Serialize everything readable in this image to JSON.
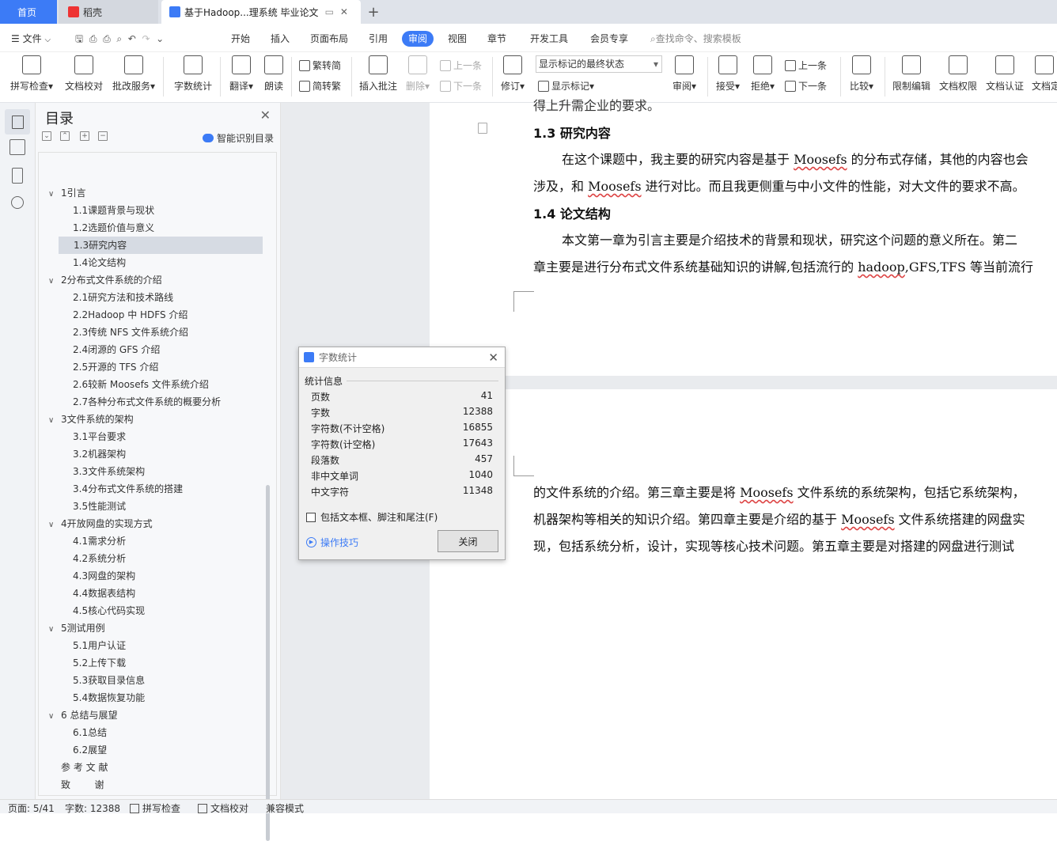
{
  "tabs": {
    "home": "首页",
    "daoke": "稻壳",
    "doc": "基于Hadoop...理系统 毕业论文",
    "add": "+"
  },
  "menu": {
    "file": "文件",
    "items": [
      "开始",
      "插入",
      "页面布局",
      "引用",
      "审阅",
      "视图",
      "章节",
      "开发工具",
      "会员专享"
    ],
    "search": "查找命令、搜索模板"
  },
  "ribbon": {
    "spell": "拼写检查",
    "proof": "文档校对",
    "batch": "批改服务",
    "wordcount": "字数统计",
    "translate": "翻译",
    "read": "朗读",
    "trad": "繁转简",
    "simp": "简转繁",
    "insert_comment": "插入批注",
    "delete": "删除",
    "prev_comment": "上一条",
    "next_comment": "下一条",
    "revise": "修订",
    "markup_state": "显示标记的最终状态",
    "show_markup": "显示标记",
    "review": "审阅",
    "accept": "接受",
    "reject": "拒绝",
    "prev": "上一条",
    "next": "下一条",
    "compare": "比较",
    "restrict": "限制编辑",
    "permission": "文档权限",
    "certify": "文档认证",
    "doc_more": "文档定"
  },
  "toc": {
    "title": "目录",
    "smart": "智能识别目录",
    "items": [
      {
        "text": "1引言",
        "level": 1
      },
      {
        "text": "1.1课题背景与现状",
        "level": 2
      },
      {
        "text": "1.2选题价值与意义",
        "level": 2
      },
      {
        "text": "1.3研究内容",
        "level": 2,
        "selected": true
      },
      {
        "text": "1.4论文结构",
        "level": 2
      },
      {
        "text": "2分布式文件系统的介绍",
        "level": 1
      },
      {
        "text": "2.1研究方法和技术路线",
        "level": 2
      },
      {
        "text": "2.2Hadoop 中 HDFS 介绍",
        "level": 2
      },
      {
        "text": "2.3传统 NFS 文件系统介绍",
        "level": 2
      },
      {
        "text": "2.4闭源的 GFS 介绍",
        "level": 2
      },
      {
        "text": "2.5开源的 TFS 介绍",
        "level": 2
      },
      {
        "text": "2.6较新 Moosefs 文件系统介绍",
        "level": 2
      },
      {
        "text": "2.7各种分布式文件系统的概要分析",
        "level": 2
      },
      {
        "text": "3文件系统的架构",
        "level": 1
      },
      {
        "text": "3.1平台要求",
        "level": 2
      },
      {
        "text": "3.2机器架构",
        "level": 2
      },
      {
        "text": "3.3文件系统架构",
        "level": 2
      },
      {
        "text": "3.4分布式文件系统的搭建",
        "level": 2
      },
      {
        "text": "3.5性能测试",
        "level": 2
      },
      {
        "text": "4开放网盘的实现方式",
        "level": 1
      },
      {
        "text": "4.1需求分析",
        "level": 2
      },
      {
        "text": "4.2系统分析",
        "level": 2
      },
      {
        "text": "4.3网盘的架构",
        "level": 2
      },
      {
        "text": "4.4数据表结构",
        "level": 2
      },
      {
        "text": "4.5核心代码实现",
        "level": 2
      },
      {
        "text": "5测试用例",
        "level": 1
      },
      {
        "text": "5.1用户认证",
        "level": 2
      },
      {
        "text": "5.2上传下载",
        "level": 2
      },
      {
        "text": "5.3获取目录信息",
        "level": 2
      },
      {
        "text": "5.4数据恢复功能",
        "level": 2
      },
      {
        "text": "6 总结与展望",
        "level": 1
      },
      {
        "text": "6.1总结",
        "level": 2
      },
      {
        "text": "6.2展望",
        "level": 2
      },
      {
        "text": "参 考 文 献",
        "level": 0
      },
      {
        "text": "致        谢",
        "level": 0
      }
    ]
  },
  "document": {
    "line0": "得上升需企业的要求。",
    "h13": "1.3  研究内容",
    "p1a_pre": "在这个课题中，我主要的研究内容是基于 ",
    "p1a_w": "Moosefs",
    "p1a_post": " 的分布式存储，其他的内容也会",
    "p1b_pre": "涉及，和 ",
    "p1b_w": "Moosefs",
    "p1b_post": " 进行对比。而且我更侧重与中小文件的性能，对大文件的要求不高。",
    "h14": "1.4  论文结构",
    "p2a": "本文第一章为引言主要是介绍技术的背景和现状，研究这个问题的意义所在。第二",
    "p2b_pre": "章主要是进行分布式文件系统基础知识的讲解,包括流行的 ",
    "p2b_w": "hadoop",
    "p2b_post": ",GFS,TFS 等当前流行",
    "p3a_pre": "的文件系统的介绍。第三章主要是将 ",
    "p3a_w": "Moosefs",
    "p3a_post": " 文件系统的系统架构，包括它系统架构，",
    "p3b_pre": "机器架构等相关的知识介绍。第四章主要是介绍的基于 ",
    "p3b_w": "Moosefs",
    "p3b_post": " 文件系统搭建的网盘实",
    "p3c": "现，包括系统分析，设计，实现等核心技术问题。第五章主要是对搭建的网盘进行测试"
  },
  "dialog": {
    "title": "字数统计",
    "group": "统计信息",
    "stats": [
      {
        "label": "页数",
        "value": "41"
      },
      {
        "label": "字数",
        "value": "12388"
      },
      {
        "label": "字符数(不计空格)",
        "value": "16855"
      },
      {
        "label": "字符数(计空格)",
        "value": "17643"
      },
      {
        "label": "段落数",
        "value": "457"
      },
      {
        "label": "非中文单词",
        "value": "1040"
      },
      {
        "label": "中文字符",
        "value": "11348"
      }
    ],
    "checkbox": "包括文本框、脚注和尾注(F)",
    "tips": "操作技巧",
    "close": "关闭"
  },
  "status": {
    "page": "页面: 5/41",
    "words": "字数: 12388",
    "spell": "拼写检查",
    "proof": "文档校对",
    "compat": "兼容模式"
  },
  "colors": {
    "accent": "#3c7bf6",
    "wavy": "#d44444"
  }
}
